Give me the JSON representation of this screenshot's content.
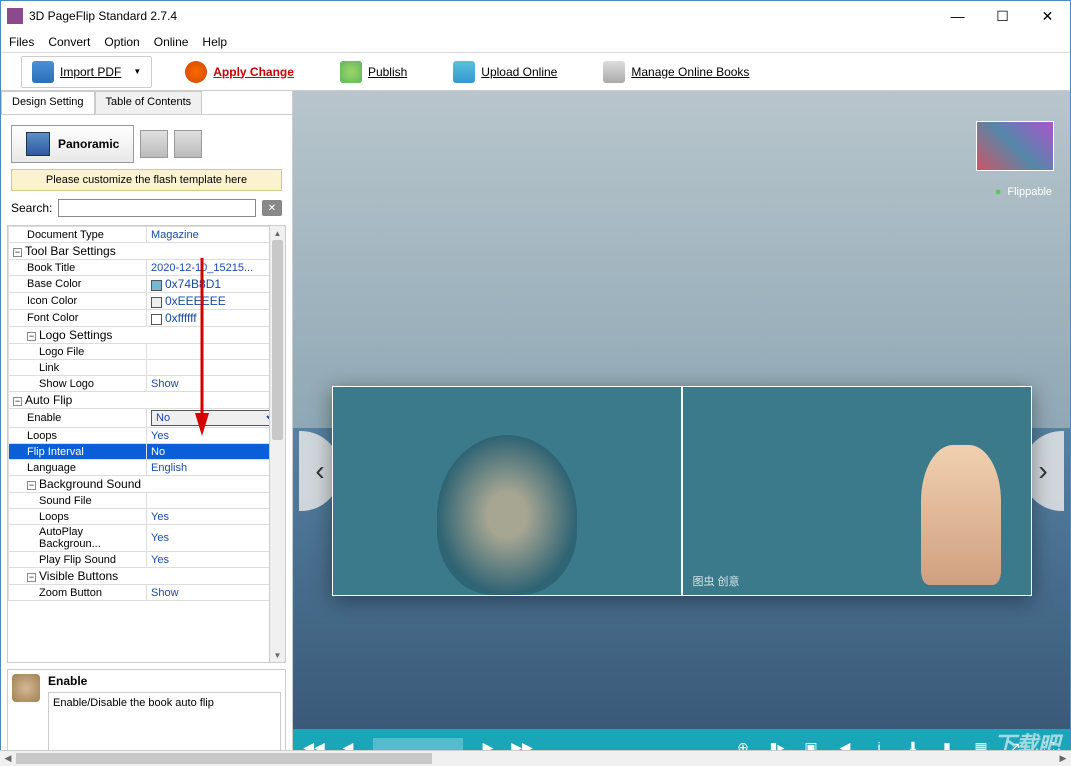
{
  "window": {
    "title": "3D PageFlip Standard 2.7.4"
  },
  "menu": [
    "Files",
    "Convert",
    "Option",
    "Online",
    "Help"
  ],
  "toolbar": {
    "import": "Import PDF",
    "apply": "Apply Change",
    "publish": "Publish",
    "upload": "Upload Online",
    "manage": "Manage Online Books"
  },
  "tabs": {
    "design": "Design Setting",
    "toc": "Table of Contents"
  },
  "panorama": "Panoramic",
  "customize": "Please customize the flash template here",
  "search_label": "Search:",
  "props": {
    "document_type": {
      "k": "Document Type",
      "v": "Magazine"
    },
    "toolbar_settings": "Tool Bar Settings",
    "book_title": {
      "k": "Book Title",
      "v": "2020-12-10_15215..."
    },
    "base_color": {
      "k": "Base Color",
      "v": "0x74B8D1",
      "c": "#74B8D1"
    },
    "icon_color": {
      "k": "Icon Color",
      "v": "0xEEEEEE",
      "c": "#EEEEEE"
    },
    "font_color": {
      "k": "Font Color",
      "v": "0xffffff",
      "c": "#ffffff"
    },
    "logo_settings": "Logo Settings",
    "logo_file": {
      "k": "Logo File",
      "v": ""
    },
    "link": {
      "k": "Link",
      "v": ""
    },
    "show_logo": {
      "k": "Show Logo",
      "v": "Show"
    },
    "auto_flip": "Auto Flip",
    "enable": {
      "k": "Enable",
      "v": "No"
    },
    "loops": {
      "k": "Loops",
      "v": "Yes"
    },
    "flip_interval": {
      "k": "Flip Interval",
      "v": "No"
    },
    "language": {
      "k": "Language",
      "v": "English"
    },
    "bg_sound": "Background Sound",
    "sound_file": {
      "k": "Sound File",
      "v": ""
    },
    "loops2": {
      "k": "Loops",
      "v": "Yes"
    },
    "autoplay_bg": {
      "k": "AutoPlay Backgroun...",
      "v": "Yes"
    },
    "play_flip": {
      "k": "Play Flip Sound",
      "v": "Yes"
    },
    "visible_buttons": "Visible Buttons",
    "zoom_btn": {
      "k": "Zoom Button",
      "v": "Show"
    }
  },
  "desc": {
    "title": "Enable",
    "text": "Enable/Disable the book auto flip"
  },
  "preview": {
    "flippable": "Flippable",
    "page_watermark": "图虫 创意",
    "site_watermark": "下载吧"
  }
}
